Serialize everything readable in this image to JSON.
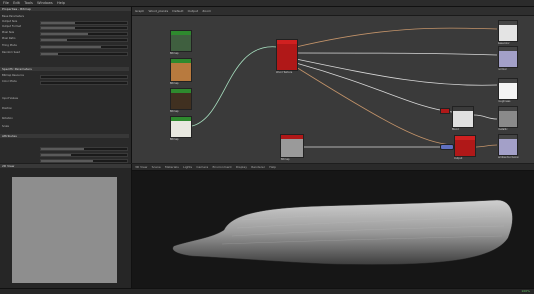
{
  "menubar": {
    "items": [
      "File",
      "Edit",
      "Tools",
      "Windows",
      "Help"
    ]
  },
  "properties": {
    "title": "Properties - Bitmap",
    "rows": [
      "Base Parameters",
      "Output Size",
      "Output Format",
      "Pixel Size",
      "Pixel Ratio",
      "Tiling Mode",
      "Random Seed",
      "Specific Parameters",
      "Bitmap Resource",
      "Color Mode",
      "Input Values",
      "Position",
      "Rotation",
      "Scale"
    ],
    "section_title": "Attributes"
  },
  "graph": {
    "tab": "Graph",
    "toolbar": [
      "Wood_planks",
      "Default",
      "Output",
      "Zoom"
    ],
    "node_labels": {
      "grain": "Bitmap",
      "wood": "Bitmap",
      "mask": "Bitmap",
      "bright": "Bitmap",
      "source": "Bitmap",
      "wood_node": "Wood Texture",
      "levels": "Levels",
      "blend_out": "Blend",
      "red": "Output",
      "out_base": "basecolor",
      "out_normal": "normal",
      "out_rough": "roughness",
      "out_metal": "metallic",
      "out_height": "height",
      "out_ao": "ambientocclusion"
    },
    "colors": {
      "link_green": "#a8e0c0",
      "link_orange": "#c4946a",
      "link_white": "#d8d8d8",
      "node_red": "#b01818",
      "node_green": "#2e8a2e"
    }
  },
  "view2d": {
    "title": "2D View"
  },
  "view3d": {
    "title": "3D View",
    "toolbar": [
      "Scene",
      "Materials",
      "Lights",
      "Camera",
      "Environment",
      "Display",
      "Renderer",
      "Help"
    ]
  },
  "status": {
    "zoom": "100%"
  }
}
